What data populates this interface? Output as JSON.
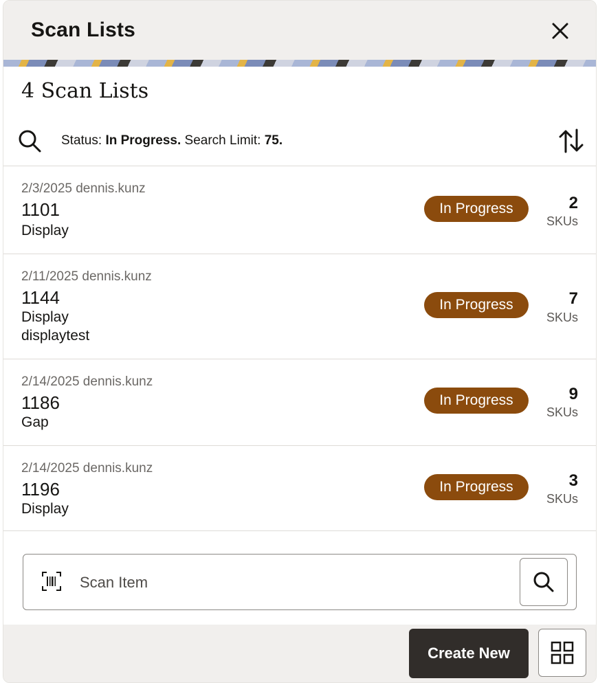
{
  "header": {
    "title": "Scan Lists"
  },
  "summary": {
    "count_title": "4 Scan Lists"
  },
  "filter": {
    "status_label": "Status:",
    "status_value": "In Progress.",
    "limit_label": "Search Limit:",
    "limit_value": "75."
  },
  "rows": [
    {
      "meta": "2/3/2025 dennis.kunz",
      "number": "1101",
      "lines": [
        "Display"
      ],
      "status": "In Progress",
      "sku_count": "2",
      "sku_label": "SKUs"
    },
    {
      "meta": "2/11/2025 dennis.kunz",
      "number": "1144",
      "lines": [
        "Display",
        "displaytest"
      ],
      "status": "In Progress",
      "sku_count": "7",
      "sku_label": "SKUs"
    },
    {
      "meta": "2/14/2025 dennis.kunz",
      "number": "1186",
      "lines": [
        "Gap"
      ],
      "status": "In Progress",
      "sku_count": "9",
      "sku_label": "SKUs"
    },
    {
      "meta": "2/14/2025 dennis.kunz",
      "number": "1196",
      "lines": [
        "Display"
      ],
      "status": "In Progress",
      "sku_count": "3",
      "sku_label": "SKUs"
    }
  ],
  "scan": {
    "placeholder": "Scan Item"
  },
  "footer": {
    "create_label": "Create New"
  },
  "colors": {
    "badge": "#8b4b0d",
    "primary_button": "#312d2a",
    "header_bg": "#f1efed"
  },
  "icons": [
    "close-icon",
    "search-icon",
    "sort-icon",
    "barcode-icon",
    "grid-icon"
  ]
}
